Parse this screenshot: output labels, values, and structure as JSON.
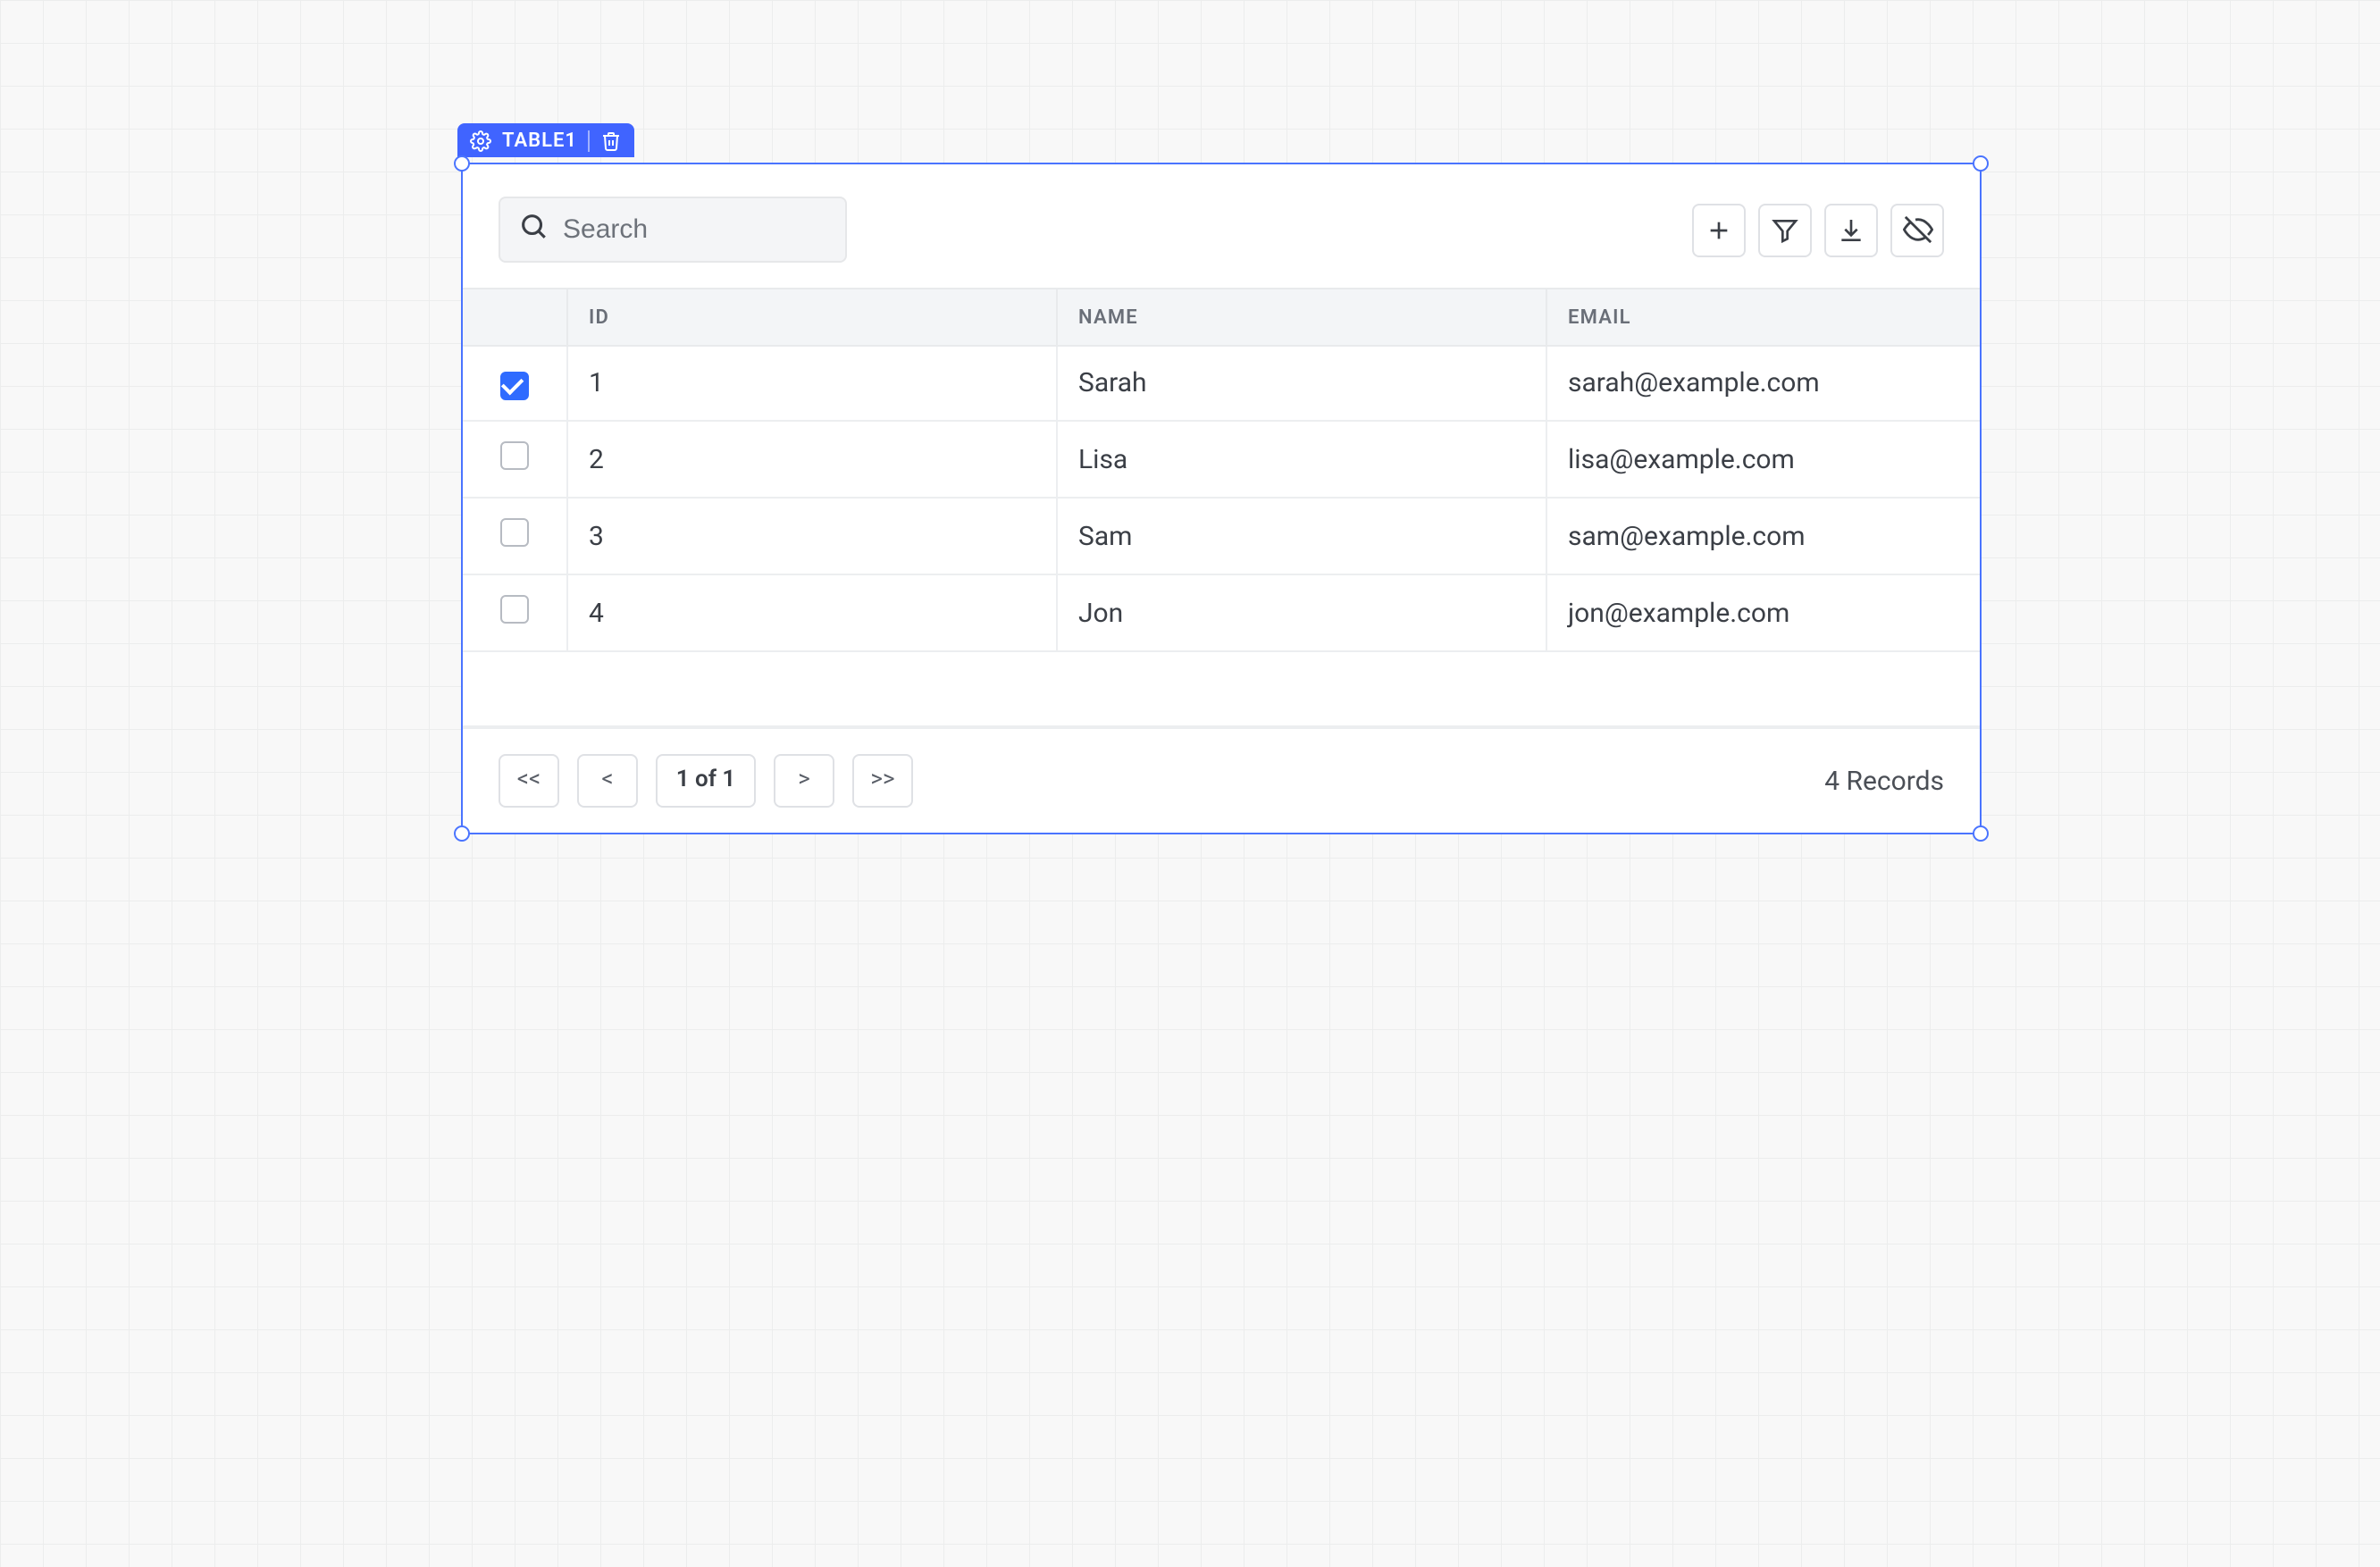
{
  "widget": {
    "label": "TABLE1"
  },
  "search": {
    "placeholder": "Search",
    "value": ""
  },
  "columns": {
    "id": "ID",
    "name": "NAME",
    "email": "EMAIL"
  },
  "rows": [
    {
      "checked": true,
      "id": "1",
      "name": "Sarah",
      "email": "sarah@example.com"
    },
    {
      "checked": false,
      "id": "2",
      "name": "Lisa",
      "email": "lisa@example.com"
    },
    {
      "checked": false,
      "id": "3",
      "name": "Sam",
      "email": "sam@example.com"
    },
    {
      "checked": false,
      "id": "4",
      "name": "Jon",
      "email": "jon@example.com"
    }
  ],
  "pagination": {
    "first": "<<",
    "prev": "<",
    "status": "1 of 1",
    "next": ">",
    "last": ">>"
  },
  "footer": {
    "record_count": "4 Records"
  }
}
